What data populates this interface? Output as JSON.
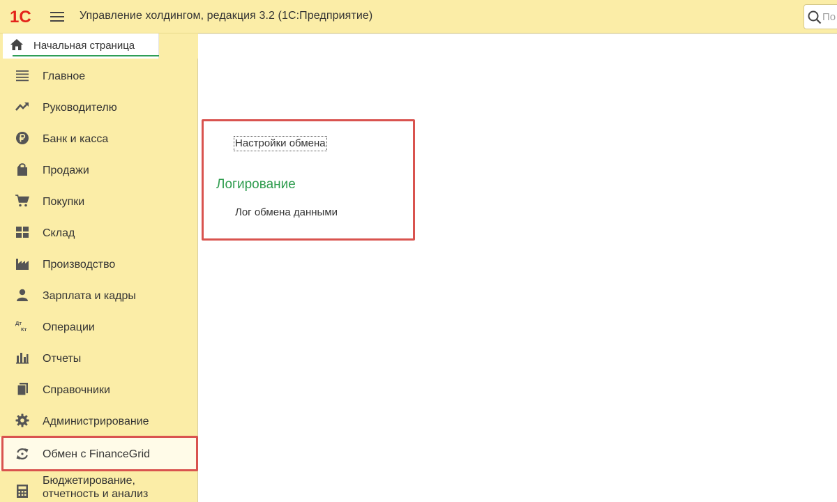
{
  "app": {
    "title": "Управление холдингом, редакция 3.2  (1С:Предприятие)",
    "logo_text": "1С"
  },
  "search": {
    "placeholder": "По"
  },
  "home_tab": {
    "label": "Начальная страница"
  },
  "sidebar": {
    "items": [
      {
        "label": "Главное",
        "icon": "menu-lines-icon"
      },
      {
        "label": "Руководителю",
        "icon": "trend-up-icon"
      },
      {
        "label": "Банк и касса",
        "icon": "ruble-coin-icon"
      },
      {
        "label": "Продажи",
        "icon": "shopping-bag-icon"
      },
      {
        "label": "Покупки",
        "icon": "shopping-cart-icon"
      },
      {
        "label": "Склад",
        "icon": "warehouse-grid-icon"
      },
      {
        "label": "Производство",
        "icon": "factory-icon"
      },
      {
        "label": "Зарплата и кадры",
        "icon": "person-icon"
      },
      {
        "label": "Операции",
        "icon": "debit-credit-icon"
      },
      {
        "label": "Отчеты",
        "icon": "bar-chart-icon"
      },
      {
        "label": "Справочники",
        "icon": "books-icon"
      },
      {
        "label": "Администрирование",
        "icon": "gear-icon"
      },
      {
        "label": "Обмен с FinanceGrid",
        "icon": "sync-icon"
      },
      {
        "label": "Бюджетирование, отчетность и анализ",
        "icon": "calculator-icon"
      }
    ],
    "selected_index": 12
  },
  "content": {
    "exchange_settings_link": "Настройки обмена",
    "logging_group_title": "Логирование",
    "exchange_log_link": "Лог обмена данными"
  },
  "colors": {
    "header_bg": "#fbeda7",
    "sidebar_bg": "#fbeda7",
    "accent_green": "#2e9c4e",
    "logo_red": "#e3241b",
    "highlight_red": "#d9534f"
  }
}
